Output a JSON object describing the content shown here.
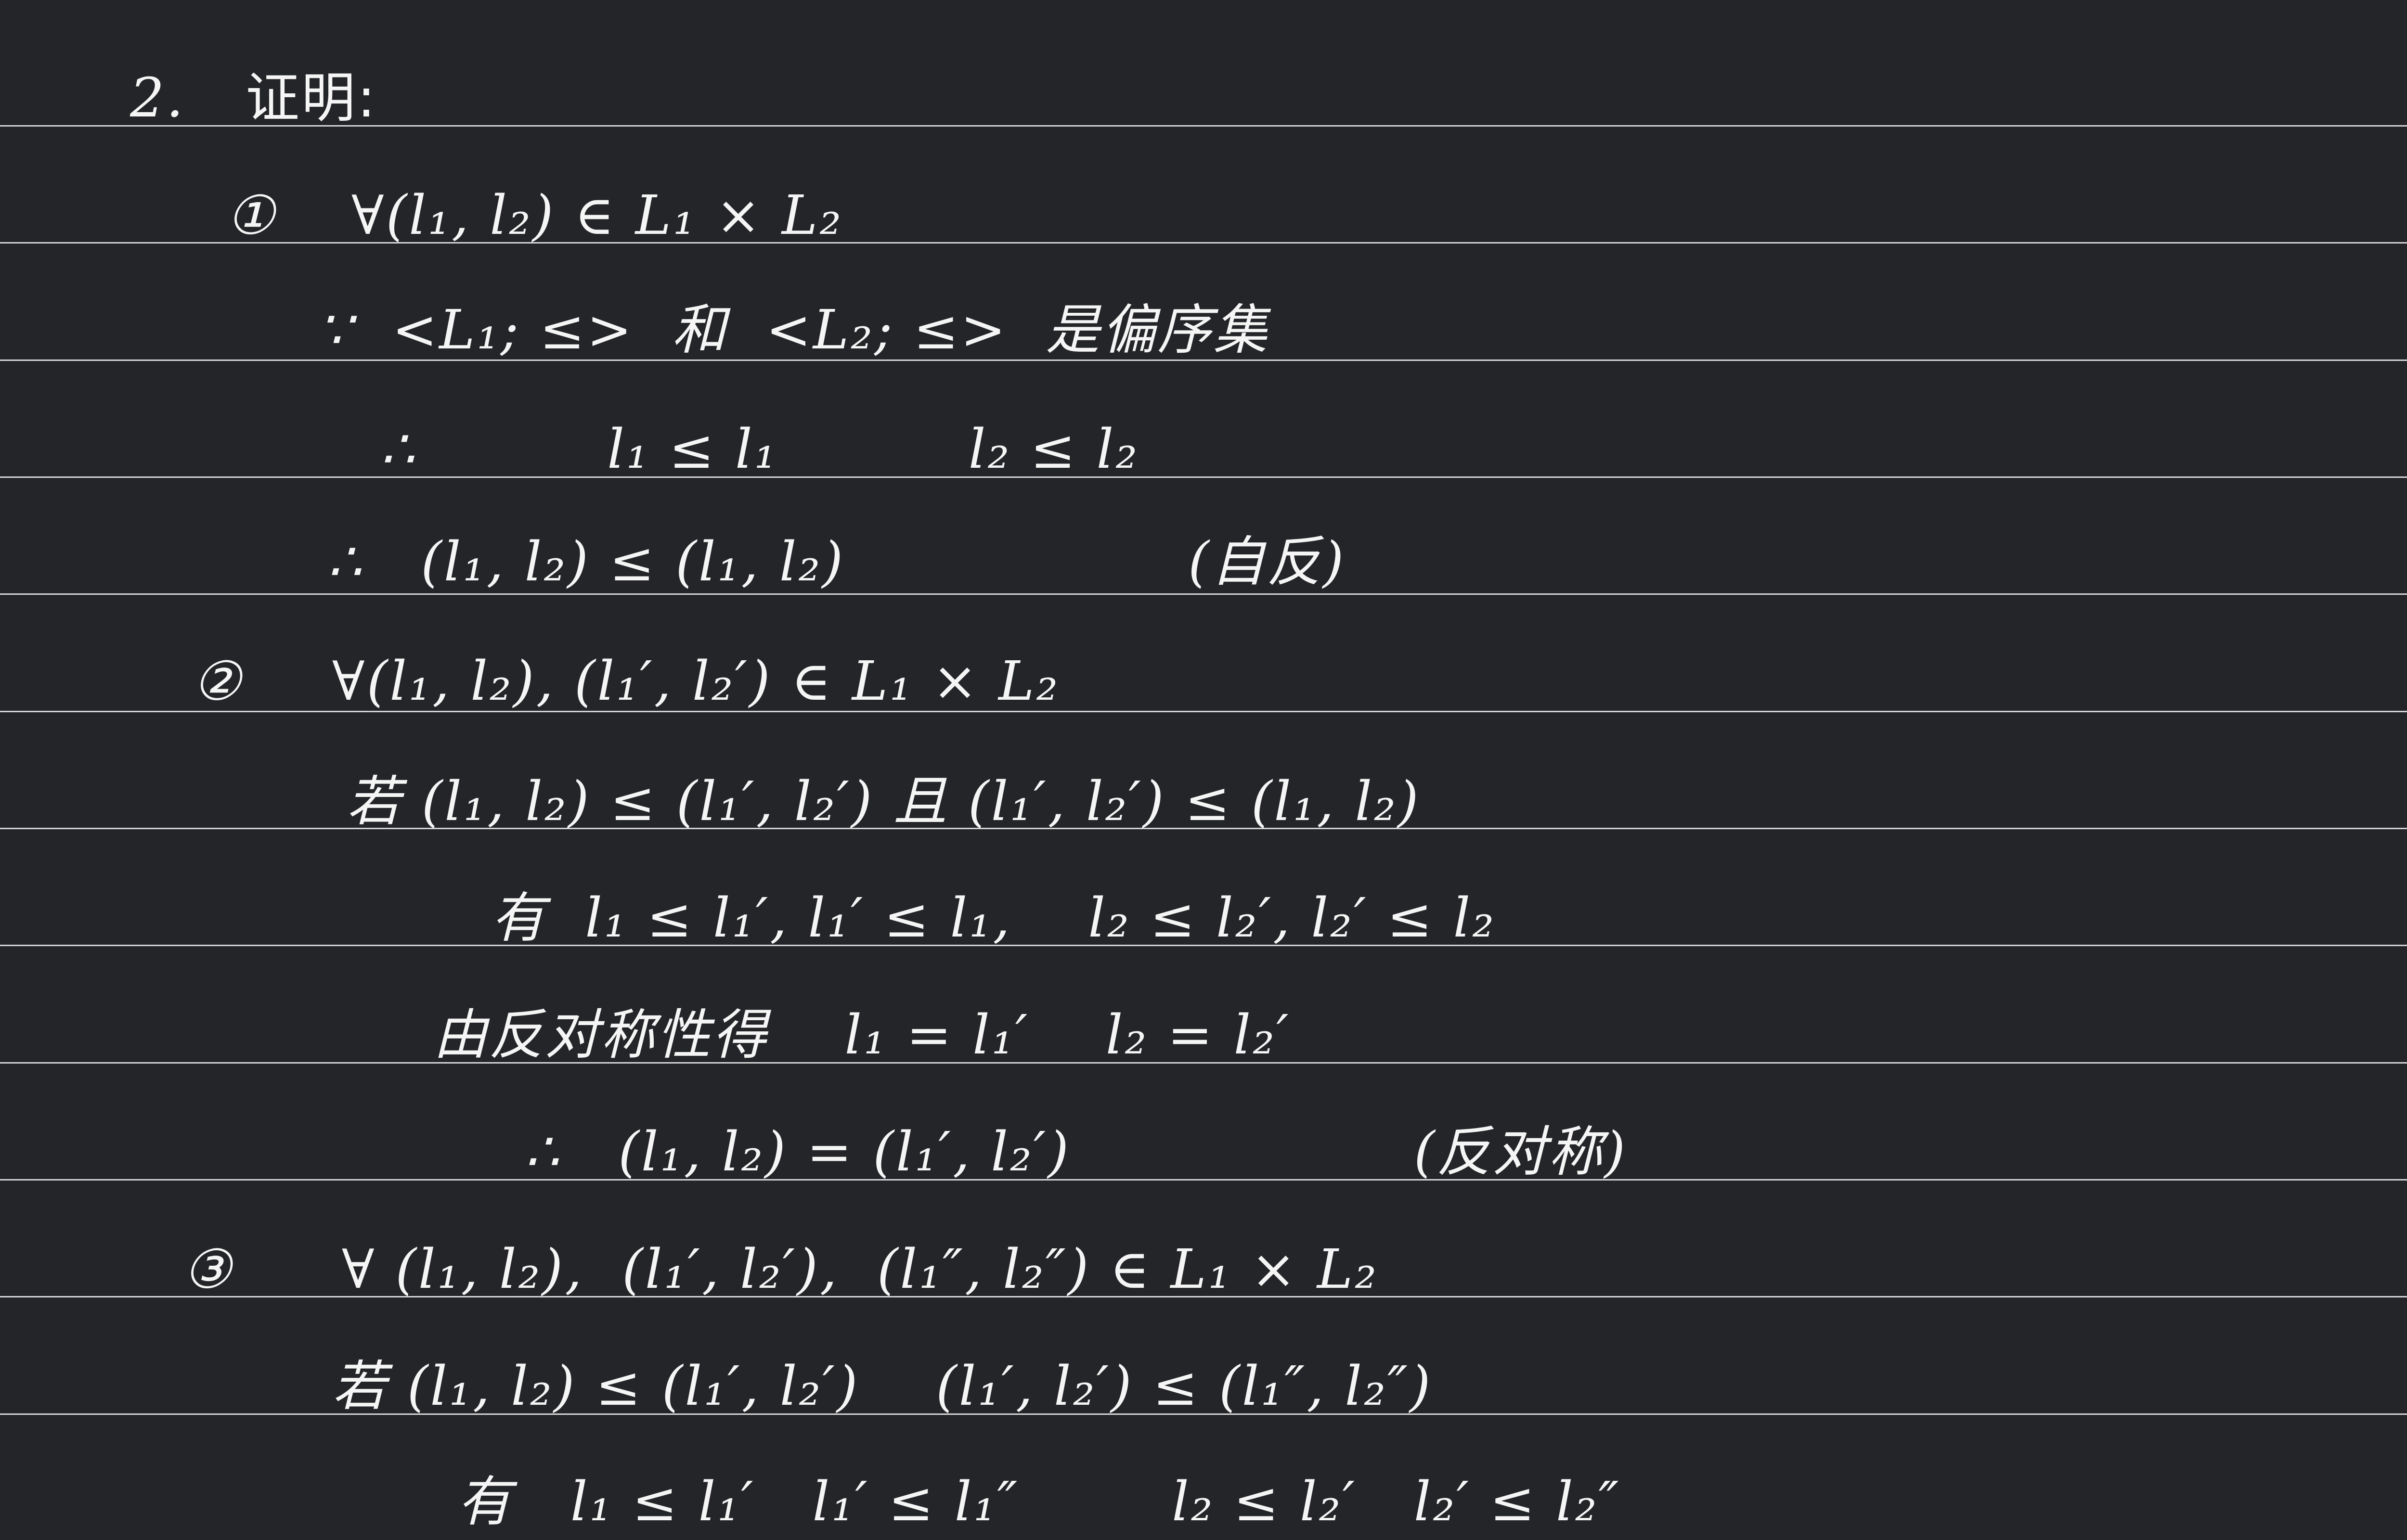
{
  "lines": [
    "2.",
    "证明:",
    "①",
    "∀(l₁, l₂) ∈ L₁ × L₂",
    "∵  <L₁; ≤>  和  <L₂; ≤>  是偏序集",
    "∴          l₁ ≤ l₁          l₂ ≤ l₂",
    "∴   (l₁, l₂) ≤ (l₁, l₂)                  (自反)",
    "②",
    "∀(l₁, l₂), (l₁′, l₂′) ∈ L₁ × L₂",
    "若 (l₁, l₂) ≤ (l₁′, l₂′) 且 (l₁′, l₂′) ≤ (l₁, l₂)",
    "有  l₁ ≤ l₁′, l₁′ ≤ l₁,    l₂ ≤ l₂′, l₂′ ≤ l₂",
    "由反对称性得    l₁ = l₁′    l₂ = l₂′",
    "∴   (l₁, l₂) = (l₁′, l₂′)                  (反对称)",
    "③",
    "∀ (l₁, l₂),  (l₁′, l₂′),  (l₁″, l₂″) ∈ L₁ × L₂",
    "若 (l₁, l₂) ≤ (l₁′, l₂′)    (l₁′, l₂′) ≤ (l₁″, l₂″)",
    "有   l₁ ≤ l₁′   l₁′ ≤ l₁″        l₂ ≤ l₂′   l₂′ ≤ l₂″"
  ]
}
